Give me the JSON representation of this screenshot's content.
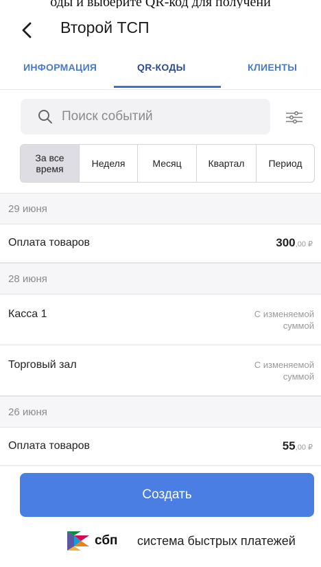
{
  "top_caption": "оды и выберите QR-код для получени",
  "header": {
    "title": "Второй ТСП"
  },
  "tabs": [
    {
      "label": "ИНФОРМАЦИЯ",
      "active": false
    },
    {
      "label": "QR-КОДЫ",
      "active": true
    },
    {
      "label": "КЛИЕНТЫ",
      "active": false
    }
  ],
  "search": {
    "placeholder": "Поиск событий",
    "value": ""
  },
  "periods": [
    {
      "label": "За все время",
      "active": true
    },
    {
      "label": "Неделя",
      "active": false
    },
    {
      "label": "Месяц",
      "active": false
    },
    {
      "label": "Квартал",
      "active": false
    },
    {
      "label": "Период",
      "active": false
    }
  ],
  "groups": [
    {
      "date": "29 июня",
      "items": [
        {
          "name": "Оплата товаров",
          "amount_int": "300",
          "amount_frac": ",00 ₽"
        }
      ]
    },
    {
      "date": "28 июня",
      "items": [
        {
          "name": "Касса 1",
          "note_line1": "С изменяемой",
          "note_line2": "суммой"
        },
        {
          "name": "Торговый зал",
          "note_line1": "С изменяемой",
          "note_line2": "суммой"
        }
      ]
    },
    {
      "date": "26 июня",
      "items": [
        {
          "name": "Оплата товаров",
          "amount_int": "55",
          "amount_frac": ",00 ₽"
        }
      ]
    }
  ],
  "actions": {
    "create_label": "Создать"
  },
  "footer": {
    "sbp_abbr": "сбп",
    "sbp_text": "система быстрых платежей"
  },
  "colors": {
    "accent": "#4a7ee3",
    "tab_active": "#2b4c8c",
    "tab_inactive": "#4a78c8"
  }
}
